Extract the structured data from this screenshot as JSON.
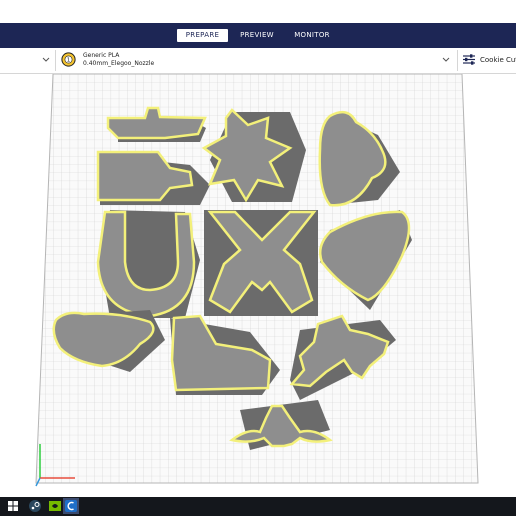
{
  "stages": {
    "prepare": "PREPARE",
    "preview": "PREVIEW",
    "monitor": "MONITOR",
    "active": "prepare"
  },
  "toolbar": {
    "material": "Generic PLA",
    "nozzle": "0.40mm_Elegoo_Nozzle",
    "profile": "Cookie Cutte"
  },
  "colors": {
    "header": "#1d2655",
    "model_outline": "#f3f07a",
    "model_fill": "#8e8e8e",
    "shadow": "#6b6b6b",
    "build_plate": "#fafafa",
    "grid": "#c8c8c8",
    "taskbar": "#14171c"
  },
  "icons": {
    "material": "material-spool-icon",
    "settings": "settings-sliders-icon",
    "taskbar": [
      "windows-icon",
      "steam-icon",
      "nvidia-icon",
      "cura-app-icon"
    ]
  },
  "models": [
    "cactus",
    "sheriff-star",
    "cowboy-hat-front",
    "bottle",
    "horseshoe",
    "crossed-pistols",
    "guitar-pick",
    "cowboy-hat",
    "cowboy-boot",
    "bull-rider",
    "longhorn-skull"
  ]
}
